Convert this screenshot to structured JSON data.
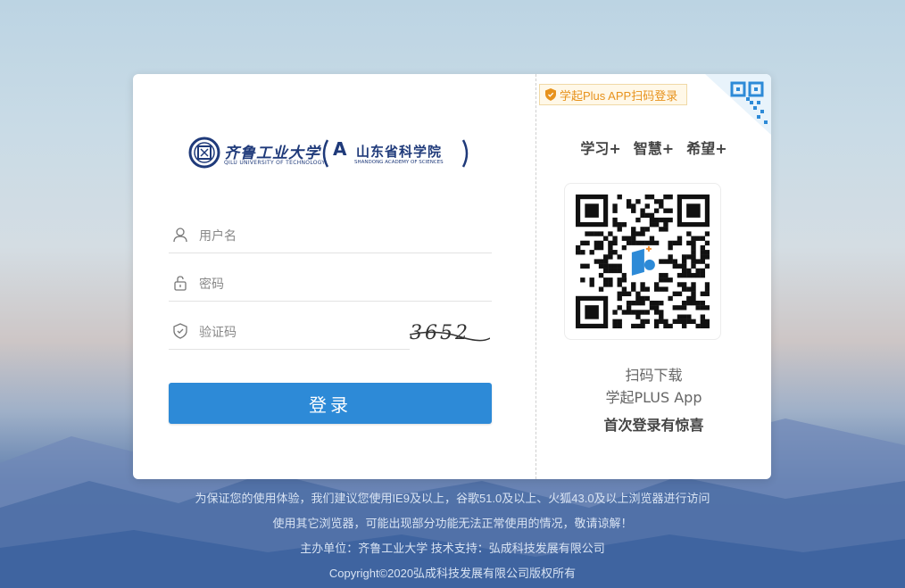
{
  "logo": {
    "school_cn": "齐鲁工业大学",
    "school_en": "QILU UNIVERSITY OF TECHNOLOGY",
    "academy_mark": "A",
    "academy_cn": "山东省科学院",
    "academy_en": "SHANDONG ACADEMY OF SCIENCES"
  },
  "form": {
    "username_placeholder": "用户名",
    "password_placeholder": "密码",
    "captcha_placeholder": "验证码",
    "captcha_value": "3652",
    "login_label": "登录"
  },
  "app": {
    "badge": "学起Plus APP扫码登录",
    "tags": [
      "学习+",
      "智慧+",
      "希望+"
    ],
    "line1": "扫码下载",
    "line2": "学起PLUS App",
    "line3": "首次登录有惊喜"
  },
  "footer": {
    "line1": "为保证您的使用体验，我们建议您使用IE9及以上，谷歌51.0及以上、火狐43.0及以上浏览器进行访问",
    "line2": "使用其它浏览器，可能出现部分功能无法正常使用的情况，敬请谅解！",
    "line3": "主办单位：齐鲁工业大学  技术支持：弘成科技发展有限公司",
    "line4": "Copyright©2020弘成科技发展有限公司版权所有"
  },
  "colors": {
    "primary": "#2d8ad7",
    "badge_text": "#e7921c",
    "logo_blue": "#1f3a7a"
  },
  "icons": [
    "user-icon",
    "lock-icon",
    "shield-icon",
    "qr-corner-icon",
    "qr-code-icon"
  ]
}
